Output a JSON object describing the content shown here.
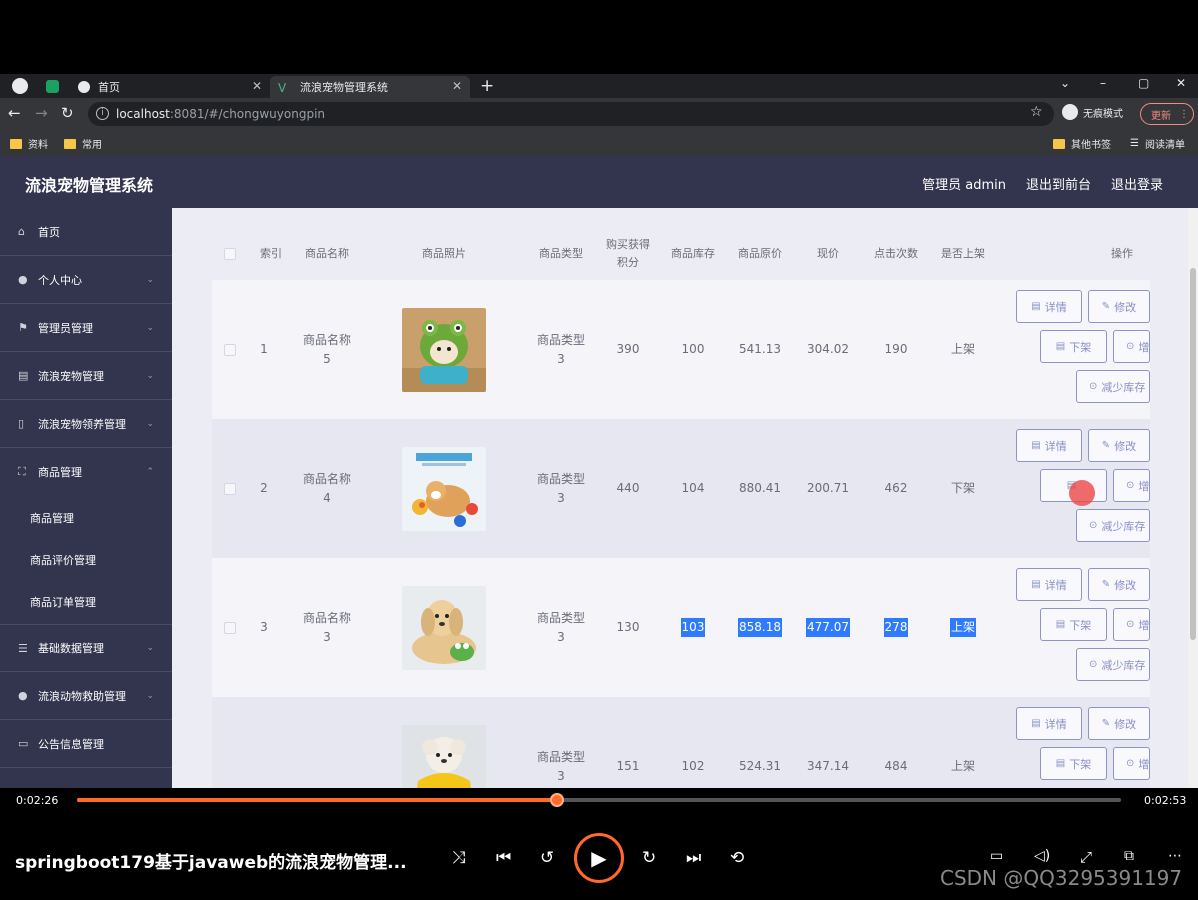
{
  "browser": {
    "tabs": [
      {
        "label": "首页",
        "active": false
      },
      {
        "label": "流浪宠物管理系统",
        "active": true
      }
    ],
    "new_tab": "+",
    "url_host": "localhost",
    "url_path": ":8081/#/chongwuyongpin",
    "incognito_label": "无痕模式",
    "update_label": "更新",
    "bookmarks": [
      "资料",
      "常用"
    ],
    "bookmarks_right": [
      "其他书签",
      "阅读清单"
    ]
  },
  "app": {
    "title": "流浪宠物管理系统",
    "header_links": [
      "管理员 admin",
      "退出到前台",
      "退出登录"
    ]
  },
  "sidebar": {
    "items": [
      {
        "label": "首页",
        "icon": "home-icon"
      },
      {
        "label": "个人中心",
        "icon": "user-icon"
      },
      {
        "label": "管理员管理",
        "icon": "flag-icon"
      },
      {
        "label": "流浪宠物管理",
        "icon": "list-icon"
      },
      {
        "label": "流浪宠物领养管理",
        "icon": "bulb-icon"
      },
      {
        "label": "商品管理",
        "icon": "frame-icon"
      },
      {
        "label": "基础数据管理",
        "icon": "menu-icon"
      },
      {
        "label": "流浪动物救助管理",
        "icon": "pin-icon"
      },
      {
        "label": "公告信息管理",
        "icon": "card-icon"
      }
    ],
    "sub_items": [
      "商品管理",
      "商品评价管理",
      "商品订单管理"
    ]
  },
  "table": {
    "headers": [
      "索引",
      "商品名称",
      "商品照片",
      "商品类型",
      "购买获得\n积分",
      "商品库存",
      "商品原价",
      "现价",
      "点击次数",
      "是否上架",
      "操作"
    ],
    "rows": [
      {
        "index": "1",
        "name": "商品名称\n5",
        "type": "商品类型\n3",
        "points": "390",
        "stock": "100",
        "price": "541.13",
        "now_price": "304.02",
        "clicks": "190",
        "status": "上架"
      },
      {
        "index": "2",
        "name": "商品名称\n4",
        "type": "商品类型\n3",
        "points": "440",
        "stock": "104",
        "price": "880.41",
        "now_price": "200.71",
        "clicks": "462",
        "status": "下架"
      },
      {
        "index": "3",
        "name": "商品名称\n3",
        "type": "商品类型\n3",
        "points": "130",
        "stock": "103",
        "price": "858.18",
        "now_price": "477.07",
        "clicks": "278",
        "status": "上架"
      },
      {
        "index": "",
        "name": "",
        "type": "商品类型\n3",
        "points": "151",
        "stock": "102",
        "price": "524.31",
        "now_price": "347.14",
        "clicks": "484",
        "status": "上架"
      }
    ],
    "actions": {
      "detail": "详情",
      "edit": "修改",
      "offshelf": "下架",
      "add_stock": "增",
      "reduce_stock": "减少库存"
    }
  },
  "player": {
    "current_time": "0:02:26",
    "total_time": "0:02:53",
    "progress": 0.46,
    "title": "springboot179基于javaweb的流浪宠物管理...",
    "watermark": "CSDN @QQ3295391197"
  }
}
